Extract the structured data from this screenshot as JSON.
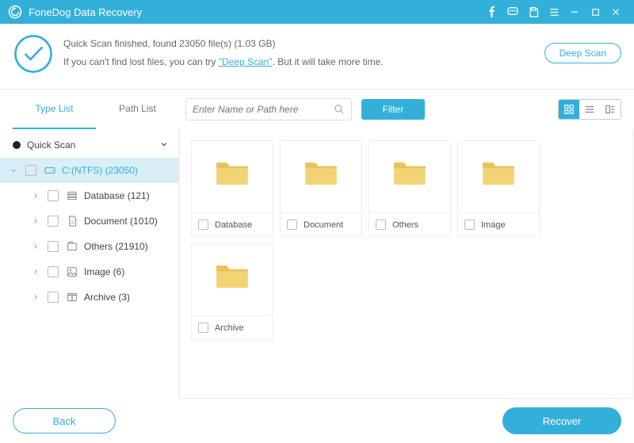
{
  "app": {
    "title": "FoneDog Data Recovery"
  },
  "status": {
    "line1_prefix": "Quick Scan finished, found ",
    "file_count": "23050",
    "line1_mid": " file(s) (",
    "total_size": "1.03 GB",
    "line1_suffix": ")",
    "line2_prefix": "If you can't find lost files, you can try ",
    "deep_scan_link": "\"Deep Scan\"",
    "line2_suffix": ". But it will take more time.",
    "deep_scan_button": "Deep Scan"
  },
  "tabs": {
    "type_list": "Type List",
    "path_list": "Path List"
  },
  "search": {
    "placeholder": "Enter Name or Path here"
  },
  "filter_label": "Filter",
  "tree": {
    "root": "Quick Scan",
    "drive": "C:(NTFS) (23050)",
    "children": [
      {
        "label": "Database (121)"
      },
      {
        "label": "Document (1010)"
      },
      {
        "label": "Others (21910)"
      },
      {
        "label": "Image (6)"
      },
      {
        "label": "Archive (3)"
      }
    ]
  },
  "grid": {
    "items": [
      {
        "name": "Database"
      },
      {
        "name": "Document"
      },
      {
        "name": "Others"
      },
      {
        "name": "Image"
      },
      {
        "name": "Archive"
      }
    ]
  },
  "footer": {
    "back": "Back",
    "recover": "Recover"
  }
}
